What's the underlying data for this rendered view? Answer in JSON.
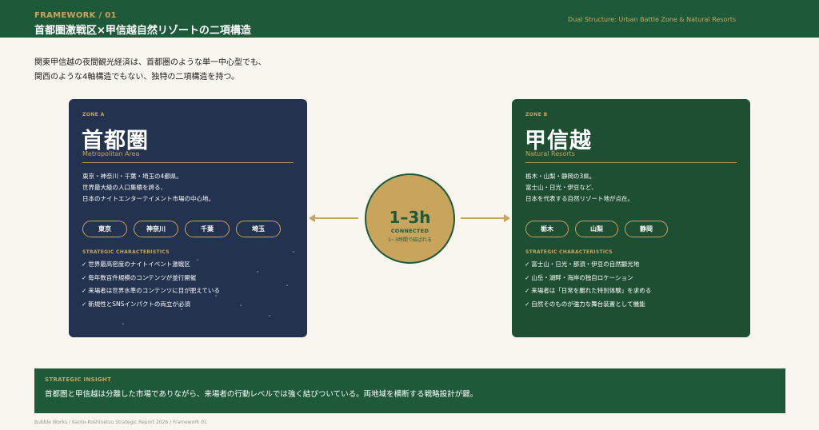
{
  "header": {
    "kicker": "FRAMEWORK / 01",
    "title": "首都圏激戦区×甲信越自然リゾートの二項構造",
    "right_caption": "Dual Structure: Urban Battle Zone & Natural Resorts"
  },
  "lead": {
    "line1": "関東甲信越の夜間観光経済は、首都圏のような単一中心型でも、",
    "line2": "関西のような4軸構造でもない、独特の二項構造を持つ。"
  },
  "zone_a": {
    "label": "ZONE A",
    "name": "首都圏",
    "subtitle": "Metropolitan Area",
    "desc": [
      "東京・神奈川・千葉・埼玉の4都県。",
      "世界最大級の人口集積を誇る、",
      "日本のナイトエンターテイメント市場の中心地。"
    ],
    "tags": [
      "東京",
      "神奈川",
      "千葉",
      "埼玉"
    ],
    "strategic_label": "STRATEGIC CHARACTERISTICS",
    "traits": [
      "世界最高密度のナイトイベント激戦区",
      "毎年数百件規模のコンテンツが並行開催",
      "来場者は世界水準のコンテンツに目が肥えている",
      "新規性とSNSインパクトの両立が必須"
    ]
  },
  "zone_b": {
    "label": "ZONE B",
    "name": "甲信越",
    "subtitle": "Natural Resorts",
    "desc": [
      "栃木・山梨・静岡の3県。",
      "富士山・日光・伊豆など、",
      "日本を代表する自然リゾート地が点在。"
    ],
    "tags": [
      "栃木",
      "山梨",
      "静岡"
    ],
    "strategic_label": "STRATEGIC CHARACTERISTICS",
    "traits": [
      "富士山・日光・那須・伊豆の自然観光地",
      "山岳・湖畔・海岸の独自ロケーション",
      "来場者は「日常を離れた特別体験」を求める",
      "自然そのものが強力な舞台装置として機能"
    ]
  },
  "connector": {
    "time": "1–3h",
    "label": "CONNECTED",
    "note": "1~3時間で結ばれる"
  },
  "insight": {
    "label": "STRATEGIC INSIGHT",
    "text": "首都圏と甲信越は分離した市場でありながら、来場者の行動レベルでは強く結びついている。両地域を横断する戦略設計が鍵。"
  },
  "footer": "Bubble Works / Kanto-Koshinetsu Strategic Report 2026 / Framework 01",
  "colors": {
    "header_green": "#1e5a3a",
    "gold": "#c9a45c",
    "zone_a_navy": "#22324f",
    "zone_b_green": "#1f4f33",
    "background": "#f8f6ef"
  }
}
